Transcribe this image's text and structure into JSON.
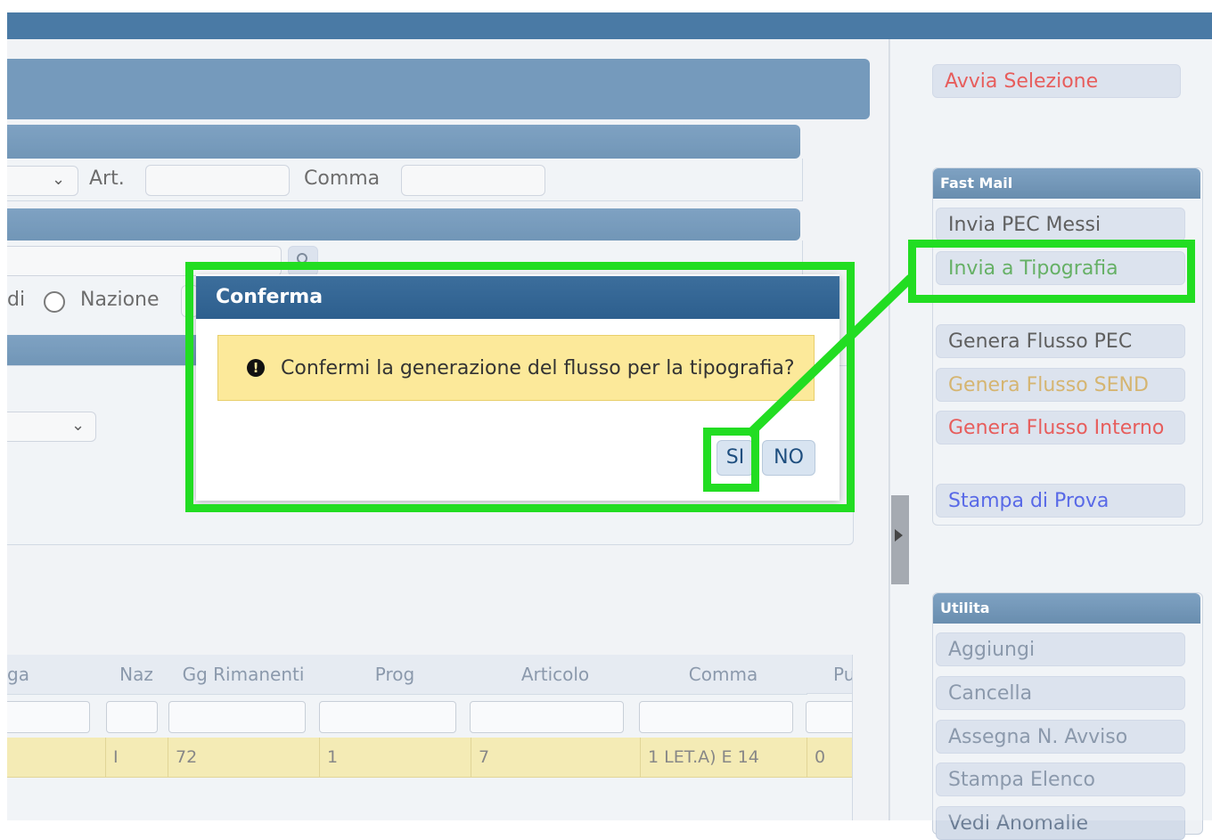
{
  "form": {
    "art_label": "Art.",
    "comma_label": "Comma",
    "radio_partial_label": "di",
    "nazione_label": "Nazione"
  },
  "table": {
    "headers": [
      "ga",
      "Naz",
      "Gg Rimanenti",
      "Prog",
      "Articolo",
      "Comma",
      "Pu"
    ],
    "row": [
      "",
      "I",
      "72",
      "1",
      "7",
      "1 LET.A) E 14",
      "0"
    ]
  },
  "sidebar": {
    "avvia_selezione": "Avvia Selezione",
    "fast_mail_title": "Fast Mail",
    "fast_mail_items": [
      "Invia PEC Messi",
      "Invia a Tipografia",
      "Genera Flusso PEC",
      "Genera Flusso SEND",
      "Genera Flusso Interno",
      "Stampa di Prova"
    ],
    "utilita_title": "Utilita",
    "utilita_items": [
      "Aggiungi",
      "Cancella",
      "Assegna N. Avviso",
      "Stampa Elenco",
      "Vedi Anomalie"
    ]
  },
  "dialog": {
    "title": "Conferma",
    "message": "Confermi la generazione del flusso per la tipografia?",
    "yes_label": "SI",
    "no_label": "NO"
  },
  "colors": {
    "header_blue": "#4a7aa5",
    "highlight_green": "#22dd22",
    "message_yellow": "#fce99a",
    "red_text": "#e0302f",
    "green_text": "#3a9a3a",
    "orange_text": "#c9a04a",
    "blue_text": "#2a3fe0"
  }
}
